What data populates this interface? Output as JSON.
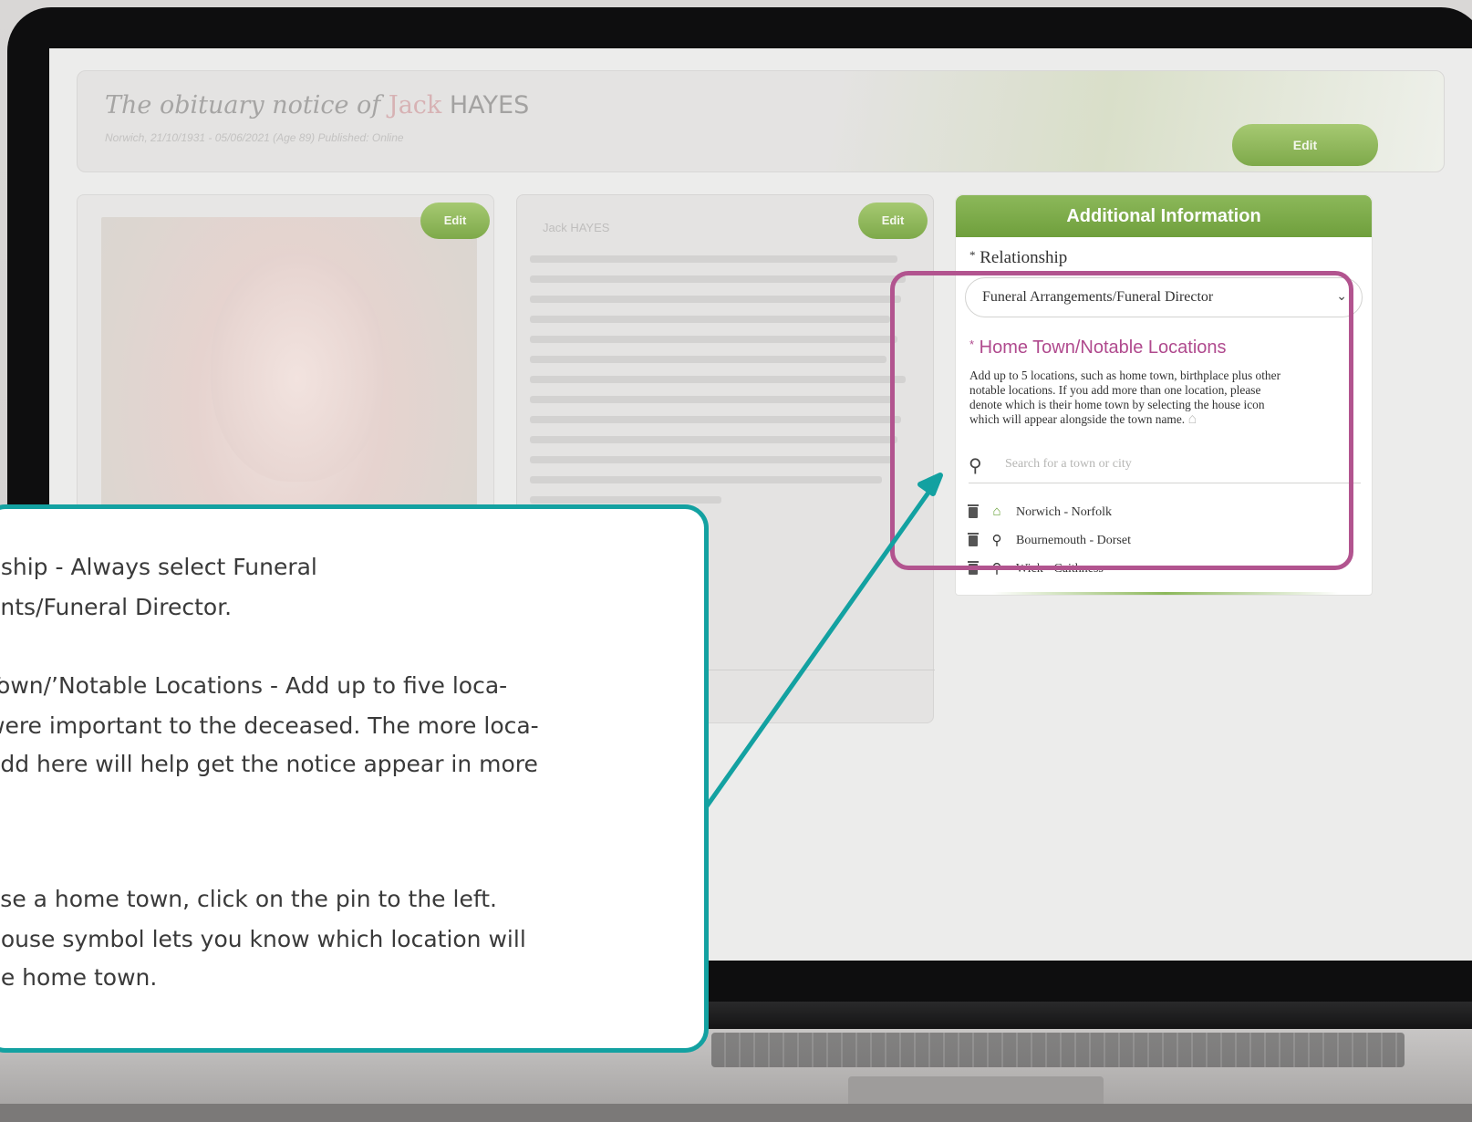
{
  "notice": {
    "title_prefix": "The obituary notice of",
    "first_name": "Jack",
    "last_name": "HAYES",
    "subtitle": "Norwich, 21/10/1931 - 05/06/2021 (Age 89) Published: Online",
    "edit_label": "Edit"
  },
  "photo_card": {
    "edit_label": "Edit"
  },
  "bio_card": {
    "name": "Jack HAYES",
    "edit_label": "Edit"
  },
  "additional_info": {
    "heading": "Additional Information",
    "relationship": {
      "required_mark": "*",
      "label": "Relationship",
      "selected_value": "Funeral Arrangements/Funeral Director"
    },
    "home_town": {
      "required_mark": "*",
      "label": "Home Town/Notable Locations",
      "description_lines": [
        "Add up to 5 locations, such as home town, birthplace plus other",
        "notable locations. If you add more than one location, please",
        "denote which is their home town by selecting the house icon",
        "which will appear alongside the town name."
      ],
      "search_placeholder": "Search for a town or city",
      "locations": [
        {
          "name": "Norwich - Norfolk",
          "icon": "house-icon",
          "is_home": true
        },
        {
          "name": "Bournemouth - Dorset",
          "icon": "pin-icon",
          "is_home": false
        },
        {
          "name": "Wick - Caithness",
          "icon": "pin-icon",
          "is_home": false
        }
      ]
    }
  },
  "callout": {
    "lines": [
      "nship - Always select Funeral",
      "ents/Funeral Director.",
      "Town/’Notable Locations - Add up to five loca-",
      "were important to the deceased. The more loca-",
      "add here will help get the notice appear in more",
      "ose a home town, click on the pin to the left.",
      " house symbol lets you know which location will",
      "he home town."
    ]
  },
  "colors": {
    "brand_green": "#7ea94a",
    "highlight_magenta": "#b2548f",
    "callout_teal": "#13a1a1",
    "label_magenta": "#b04a8e"
  }
}
